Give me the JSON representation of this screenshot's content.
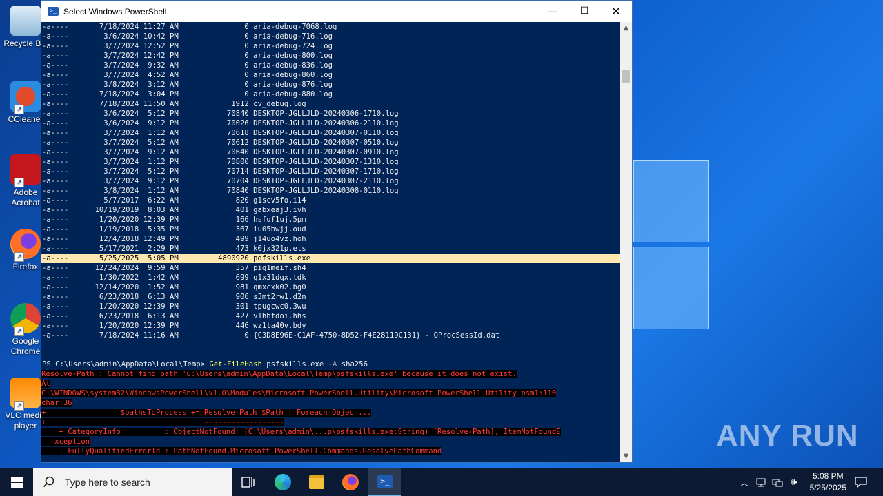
{
  "desktop_icons": [
    {
      "label": "Recycle Bin",
      "name": "recycle-bin-icon"
    },
    {
      "label": "CCleaner",
      "name": "ccleaner-icon"
    },
    {
      "label": "Adobe Acrobat",
      "name": "adobe-acrobat-icon"
    },
    {
      "label": "Firefox",
      "name": "firefox-icon"
    },
    {
      "label": "Google Chrome",
      "name": "google-chrome-icon"
    },
    {
      "label": "VLC media player",
      "name": "vlc-icon"
    }
  ],
  "window": {
    "title": "Select Windows PowerShell",
    "minimize": "—",
    "maximize": "☐",
    "close": "✕"
  },
  "listing": [
    {
      "mode": "-a----",
      "date": "7/18/2024",
      "time": "11:27 AM",
      "length": "0",
      "name": "aria-debug-7068.log"
    },
    {
      "mode": "-a----",
      "date": "3/6/2024",
      "time": "10:42 PM",
      "length": "0",
      "name": "aria-debug-716.log"
    },
    {
      "mode": "-a----",
      "date": "3/7/2024",
      "time": "12:52 PM",
      "length": "0",
      "name": "aria-debug-724.log"
    },
    {
      "mode": "-a----",
      "date": "3/7/2024",
      "time": "12:42 PM",
      "length": "0",
      "name": "aria-debug-800.log"
    },
    {
      "mode": "-a----",
      "date": "3/7/2024",
      "time": "9:32 AM",
      "length": "0",
      "name": "aria-debug-836.log"
    },
    {
      "mode": "-a----",
      "date": "3/7/2024",
      "time": "4:52 AM",
      "length": "0",
      "name": "aria-debug-860.log"
    },
    {
      "mode": "-a----",
      "date": "3/8/2024",
      "time": "3:12 AM",
      "length": "0",
      "name": "aria-debug-876.log"
    },
    {
      "mode": "-a----",
      "date": "7/18/2024",
      "time": "3:04 PM",
      "length": "0",
      "name": "aria-debug-880.log"
    },
    {
      "mode": "-a----",
      "date": "7/18/2024",
      "time": "11:50 AM",
      "length": "1912",
      "name": "cv_debug.log"
    },
    {
      "mode": "-a----",
      "date": "3/6/2024",
      "time": "5:12 PM",
      "length": "70840",
      "name": "DESKTOP-JGLLJLD-20240306-1710.log"
    },
    {
      "mode": "-a----",
      "date": "3/6/2024",
      "time": "9:12 PM",
      "length": "70026",
      "name": "DESKTOP-JGLLJLD-20240306-2110.log"
    },
    {
      "mode": "-a----",
      "date": "3/7/2024",
      "time": "1:12 AM",
      "length": "70618",
      "name": "DESKTOP-JGLLJLD-20240307-0110.log"
    },
    {
      "mode": "-a----",
      "date": "3/7/2024",
      "time": "5:12 AM",
      "length": "70612",
      "name": "DESKTOP-JGLLJLD-20240307-0510.log"
    },
    {
      "mode": "-a----",
      "date": "3/7/2024",
      "time": "9:12 AM",
      "length": "70640",
      "name": "DESKTOP-JGLLJLD-20240307-0910.log"
    },
    {
      "mode": "-a----",
      "date": "3/7/2024",
      "time": "1:12 PM",
      "length": "70800",
      "name": "DESKTOP-JGLLJLD-20240307-1310.log"
    },
    {
      "mode": "-a----",
      "date": "3/7/2024",
      "time": "5:12 PM",
      "length": "70714",
      "name": "DESKTOP-JGLLJLD-20240307-1710.log"
    },
    {
      "mode": "-a----",
      "date": "3/7/2024",
      "time": "9:12 PM",
      "length": "70704",
      "name": "DESKTOP-JGLLJLD-20240307-2110.log"
    },
    {
      "mode": "-a----",
      "date": "3/8/2024",
      "time": "1:12 AM",
      "length": "70840",
      "name": "DESKTOP-JGLLJLD-20240308-0110.log"
    },
    {
      "mode": "-a----",
      "date": "5/7/2017",
      "time": "6:22 AM",
      "length": "820",
      "name": "g1scv5fo.i14"
    },
    {
      "mode": "-a----",
      "date": "10/19/2019",
      "time": "8:03 AM",
      "length": "401",
      "name": "gabxeaj3.ivh"
    },
    {
      "mode": "-a----",
      "date": "1/20/2020",
      "time": "12:39 PM",
      "length": "166",
      "name": "hsfuf1uj.5pm"
    },
    {
      "mode": "-a----",
      "date": "1/19/2018",
      "time": "5:35 PM",
      "length": "367",
      "name": "iu05bwjj.oud"
    },
    {
      "mode": "-a----",
      "date": "12/4/2018",
      "time": "12:49 PM",
      "length": "499",
      "name": "j14uo4vz.hoh"
    },
    {
      "mode": "-a----",
      "date": "5/17/2021",
      "time": "2:29 PM",
      "length": "473",
      "name": "k0jx321p.ets"
    },
    {
      "mode": "-a----",
      "date": "5/25/2025",
      "time": "5:05 PM",
      "length": "4890920",
      "name": "pdfskills.exe",
      "highlight": true
    },
    {
      "mode": "-a----",
      "date": "12/24/2024",
      "time": "9:59 AM",
      "length": "357",
      "name": "pig1meif.sh4"
    },
    {
      "mode": "-a----",
      "date": "1/30/2022",
      "time": "1:42 AM",
      "length": "699",
      "name": "q1x31dqx.tdk"
    },
    {
      "mode": "-a----",
      "date": "12/14/2020",
      "time": "1:52 AM",
      "length": "981",
      "name": "qmxcxk02.bg0"
    },
    {
      "mode": "-a----",
      "date": "6/23/2018",
      "time": "6:13 AM",
      "length": "906",
      "name": "s3mt2rw1.d2n"
    },
    {
      "mode": "-a----",
      "date": "1/20/2020",
      "time": "12:39 PM",
      "length": "301",
      "name": "tpugcwc0.3wu"
    },
    {
      "mode": "-a----",
      "date": "6/23/2018",
      "time": "6:13 AM",
      "length": "427",
      "name": "v1hbfdoi.hhs"
    },
    {
      "mode": "-a----",
      "date": "1/20/2020",
      "time": "12:39 PM",
      "length": "446",
      "name": "wz1ta40v.bdy"
    },
    {
      "mode": "-a----",
      "date": "7/18/2024",
      "time": "11:16 AM",
      "length": "0",
      "name": "{C3D8E96E-C1AF-4750-8D52-F4E28119C131} - OProcSessId.dat"
    }
  ],
  "prompt": {
    "path": "PS C:\\Users\\admin\\AppData\\Local\\Temp> ",
    "command": "Get-FileHash",
    "args": " psfskills.exe ",
    "flag": "-A",
    "value": " sha256"
  },
  "error_lines": [
    "Resolve-Path : Cannot find path 'C:\\Users\\admin\\AppData\\Local\\Temp\\psfskills.exe' because it does not exist.",
    "At",
    "C:\\WINDOWS\\system32\\WindowsPowerShell\\v1.0\\Modules\\Microsoft.PowerShell.Utility\\Microsoft.PowerShell.Utility.psm1:110",
    "char:36",
    "+                 $pathsToProcess += Resolve-Path $Path | Foreach-Objec ...",
    "+                                    ~~~~~~~~~~~~~~~~~~",
    "    + CategoryInfo          : ObjectNotFound: (C:\\Users\\admin\\...p\\psfskills.exe:String) [Resolve-Path], ItemNotFoundE",
    "   xception",
    "    + FullyQualifiedErrorId : PathNotFound,Microsoft.PowerShell.Commands.ResolvePathCommand"
  ],
  "taskbar": {
    "search_placeholder": "Type here to search",
    "time": "5:08 PM",
    "date": "5/25/2025"
  },
  "watermark": "ANY RUN",
  "colors": {
    "console_bg": "#012456",
    "error_fg": "#ff3b3b",
    "command_fg": "#ffff5a",
    "highlight_bg": "#ffe8b0",
    "taskbar_bg": "#0c1b33"
  }
}
